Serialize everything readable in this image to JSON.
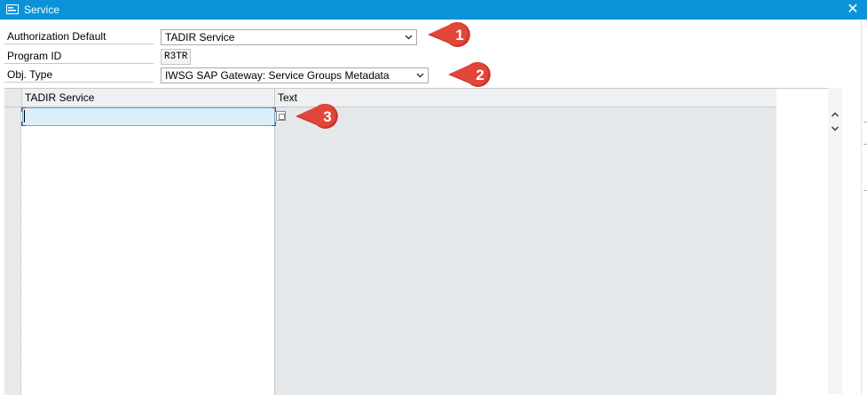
{
  "window": {
    "title": "Service",
    "close_glyph": "✕"
  },
  "form": {
    "authorization_default": {
      "label": "Authorization Default",
      "value": "TADIR Service"
    },
    "program_id": {
      "label": "Program ID",
      "value": "R3TR"
    },
    "obj_type": {
      "label": "Obj. Type",
      "value": "IWSG SAP Gateway: Service Groups Metadata"
    }
  },
  "table": {
    "columns": [
      "TADIR Service",
      "Text"
    ],
    "row_count": 16,
    "active_row_index": 0
  },
  "callouts": [
    "1",
    "2",
    "3"
  ],
  "icons": {
    "title": "window-icon",
    "dropdown": "chevron-down-icon",
    "value_help": "value-help-icon",
    "settings": "column-settings-icon",
    "scroll_up": "chevron-up-icon",
    "scroll_down": "chevron-down-icon"
  },
  "colors": {
    "titlebar": "#0a93d8",
    "callout_fill": "#e2463a",
    "grid_readonly": "#e5e8eb",
    "active_cell": "#ddeefb"
  }
}
